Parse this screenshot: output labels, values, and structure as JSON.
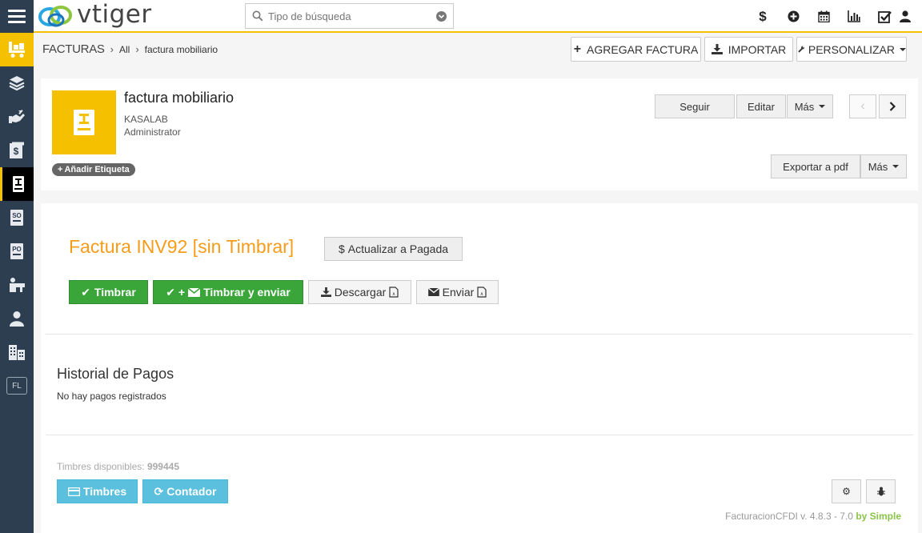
{
  "topbar": {
    "logo_text": "vtiger",
    "search_placeholder": "Tipo de búsqueda",
    "icons": [
      "dollar-icon",
      "plus-circle-icon",
      "calendar-icon",
      "bar-chart-icon",
      "checkbox-icon",
      "user-icon"
    ]
  },
  "sidebar": {
    "items": [
      "cart-icon",
      "layers-icon",
      "handshake-icon",
      "dollar-doc-icon",
      "invoice-icon",
      "so-icon",
      "po-icon",
      "person-desk-icon",
      "person-icon",
      "buildings-icon"
    ],
    "fl_label": "FL"
  },
  "breadcrumb": {
    "module": "FACTURAS",
    "level1": "All",
    "level2": "factura mobiliario"
  },
  "header_actions": {
    "add": "AGREGAR FACTURA",
    "import": "IMPORTAR",
    "customize": "PERSONALIZAR"
  },
  "record": {
    "title": "factura mobiliario",
    "org": "KASALAB",
    "owner": "Administrator",
    "add_tag": "Añadir Etiqueta",
    "follow": "Seguir",
    "edit": "Editar",
    "more": "Más",
    "export_pdf": "Exportar a pdf",
    "more2": "Más"
  },
  "invoice": {
    "title": "Factura INV92 [sin Timbrar]",
    "mark_paid": "Actualizar a Pagada",
    "stamp": "Timbrar",
    "stamp_send": "Timbrar y enviar",
    "download": "Descargar",
    "send": "Enviar"
  },
  "payments": {
    "title": "Historial de Pagos",
    "empty": "No hay pagos registrados"
  },
  "footer": {
    "available_label": "Timbres disponibles:",
    "available_value": "999445",
    "btn_timbres": "Timbres",
    "btn_contador": "Contador",
    "version": "FacturacionCFDI v. 4.8.3 - 7.0",
    "by": "by Simple"
  },
  "colors": {
    "accent": "#f4c000",
    "sidebar": "#2d3e50",
    "invoice_title": "#f59c1a",
    "green": "#3aa63a",
    "info": "#5bc0de"
  }
}
